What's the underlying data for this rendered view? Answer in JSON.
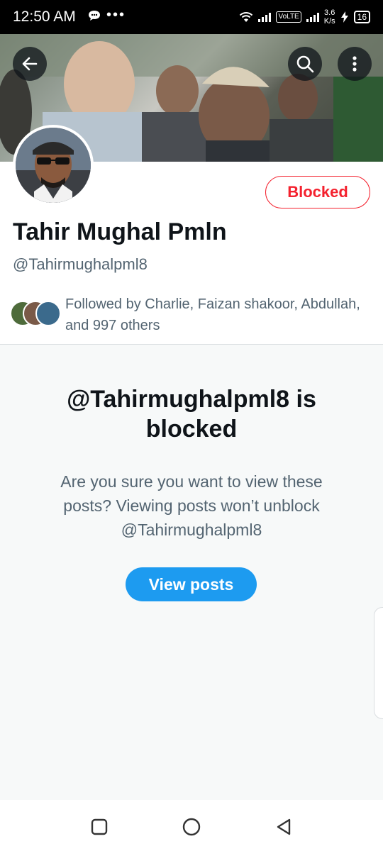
{
  "status_bar": {
    "time": "12:50 AM",
    "notif_dots": "•••",
    "volte": "VoLTE",
    "speed_value": "3.6",
    "speed_unit": "K/s",
    "battery": "16"
  },
  "header": {
    "back_icon": "arrow-left-icon",
    "search_icon": "search-icon",
    "more_icon": "more-vertical-icon"
  },
  "profile": {
    "name": "Tahir Mughal Pmln",
    "handle": "@Tahirmughalpml8",
    "blocked_label": "Blocked",
    "followed_by": "Followed by Charlie, Faizan shakoor, Abdullah, and 997 others"
  },
  "blocked_notice": {
    "title": "@Tahirmughalpml8 is blocked",
    "description_line1": "Are you sure you want to view these",
    "description_line2": "posts? Viewing posts won’t unblock",
    "description_line3": "@Tahirmughalpml8",
    "view_posts_label": "View posts"
  },
  "colors": {
    "accent": "#1d9bf0",
    "blocked_red": "#f4212e",
    "secondary_text": "#536471"
  },
  "nav_bar": {
    "recents_icon": "square-icon",
    "home_icon": "circle-icon",
    "back_icon": "triangle-back-icon"
  }
}
